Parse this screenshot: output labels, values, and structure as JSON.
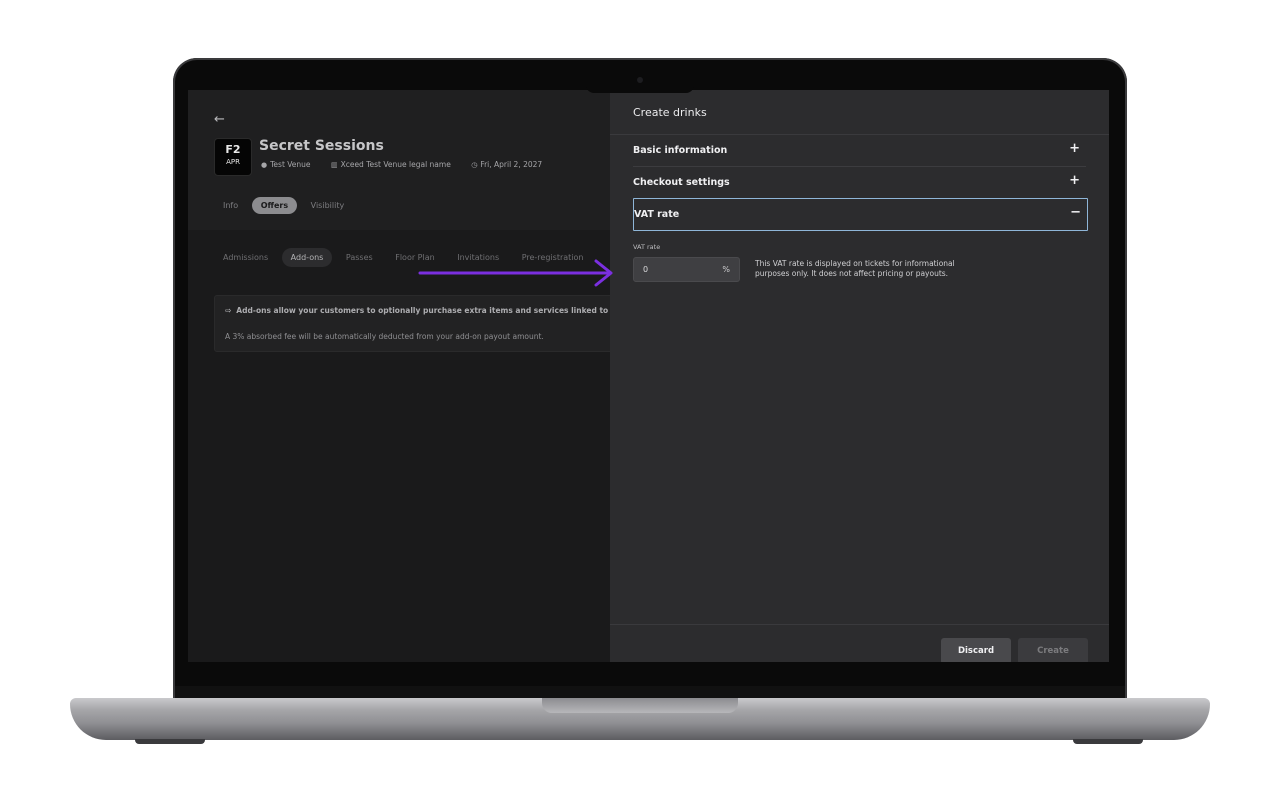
{
  "event": {
    "back_icon": "arrow-left-icon",
    "thumb_day": "F2",
    "thumb_month": "APR",
    "title": "Secret Sessions",
    "venue": "Test Venue",
    "legal_name": "Xceed Test Venue legal name",
    "date": "Fri, April 2, 2027"
  },
  "top_tabs": [
    {
      "label": "Info",
      "active": false
    },
    {
      "label": "Offers",
      "active": true
    },
    {
      "label": "Visibility",
      "active": false
    }
  ],
  "sub_tabs": [
    {
      "label": "Admissions",
      "active": false
    },
    {
      "label": "Add-ons",
      "active": true
    },
    {
      "label": "Passes",
      "active": false
    },
    {
      "label": "Floor Plan",
      "active": false
    },
    {
      "label": "Invitations",
      "active": false
    },
    {
      "label": "Pre-registration",
      "active": false
    }
  ],
  "info_card": {
    "line1": "Add-ons allow your customers to optionally purchase extra items and services linked to the se",
    "line2": "A 3% absorbed fee will be automatically deducted from your add-on payout amount."
  },
  "drawer": {
    "title": "Create drinks",
    "sections": [
      {
        "label": "Basic information",
        "toggle": "+"
      },
      {
        "label": "Checkout settings",
        "toggle": "+"
      },
      {
        "label": "VAT rate",
        "toggle": "−"
      }
    ],
    "vat": {
      "field_label": "VAT rate",
      "value": "0",
      "suffix": "%",
      "help": "This VAT rate is displayed on tickets for informational purposes only. It does not affect pricing or payouts."
    },
    "discard_label": "Discard",
    "create_label": "Create"
  },
  "colors": {
    "annotation_arrow": "#7b2fe0",
    "focus_border": "#8fb6d8",
    "drawer_bg": "#2c2c2e"
  }
}
